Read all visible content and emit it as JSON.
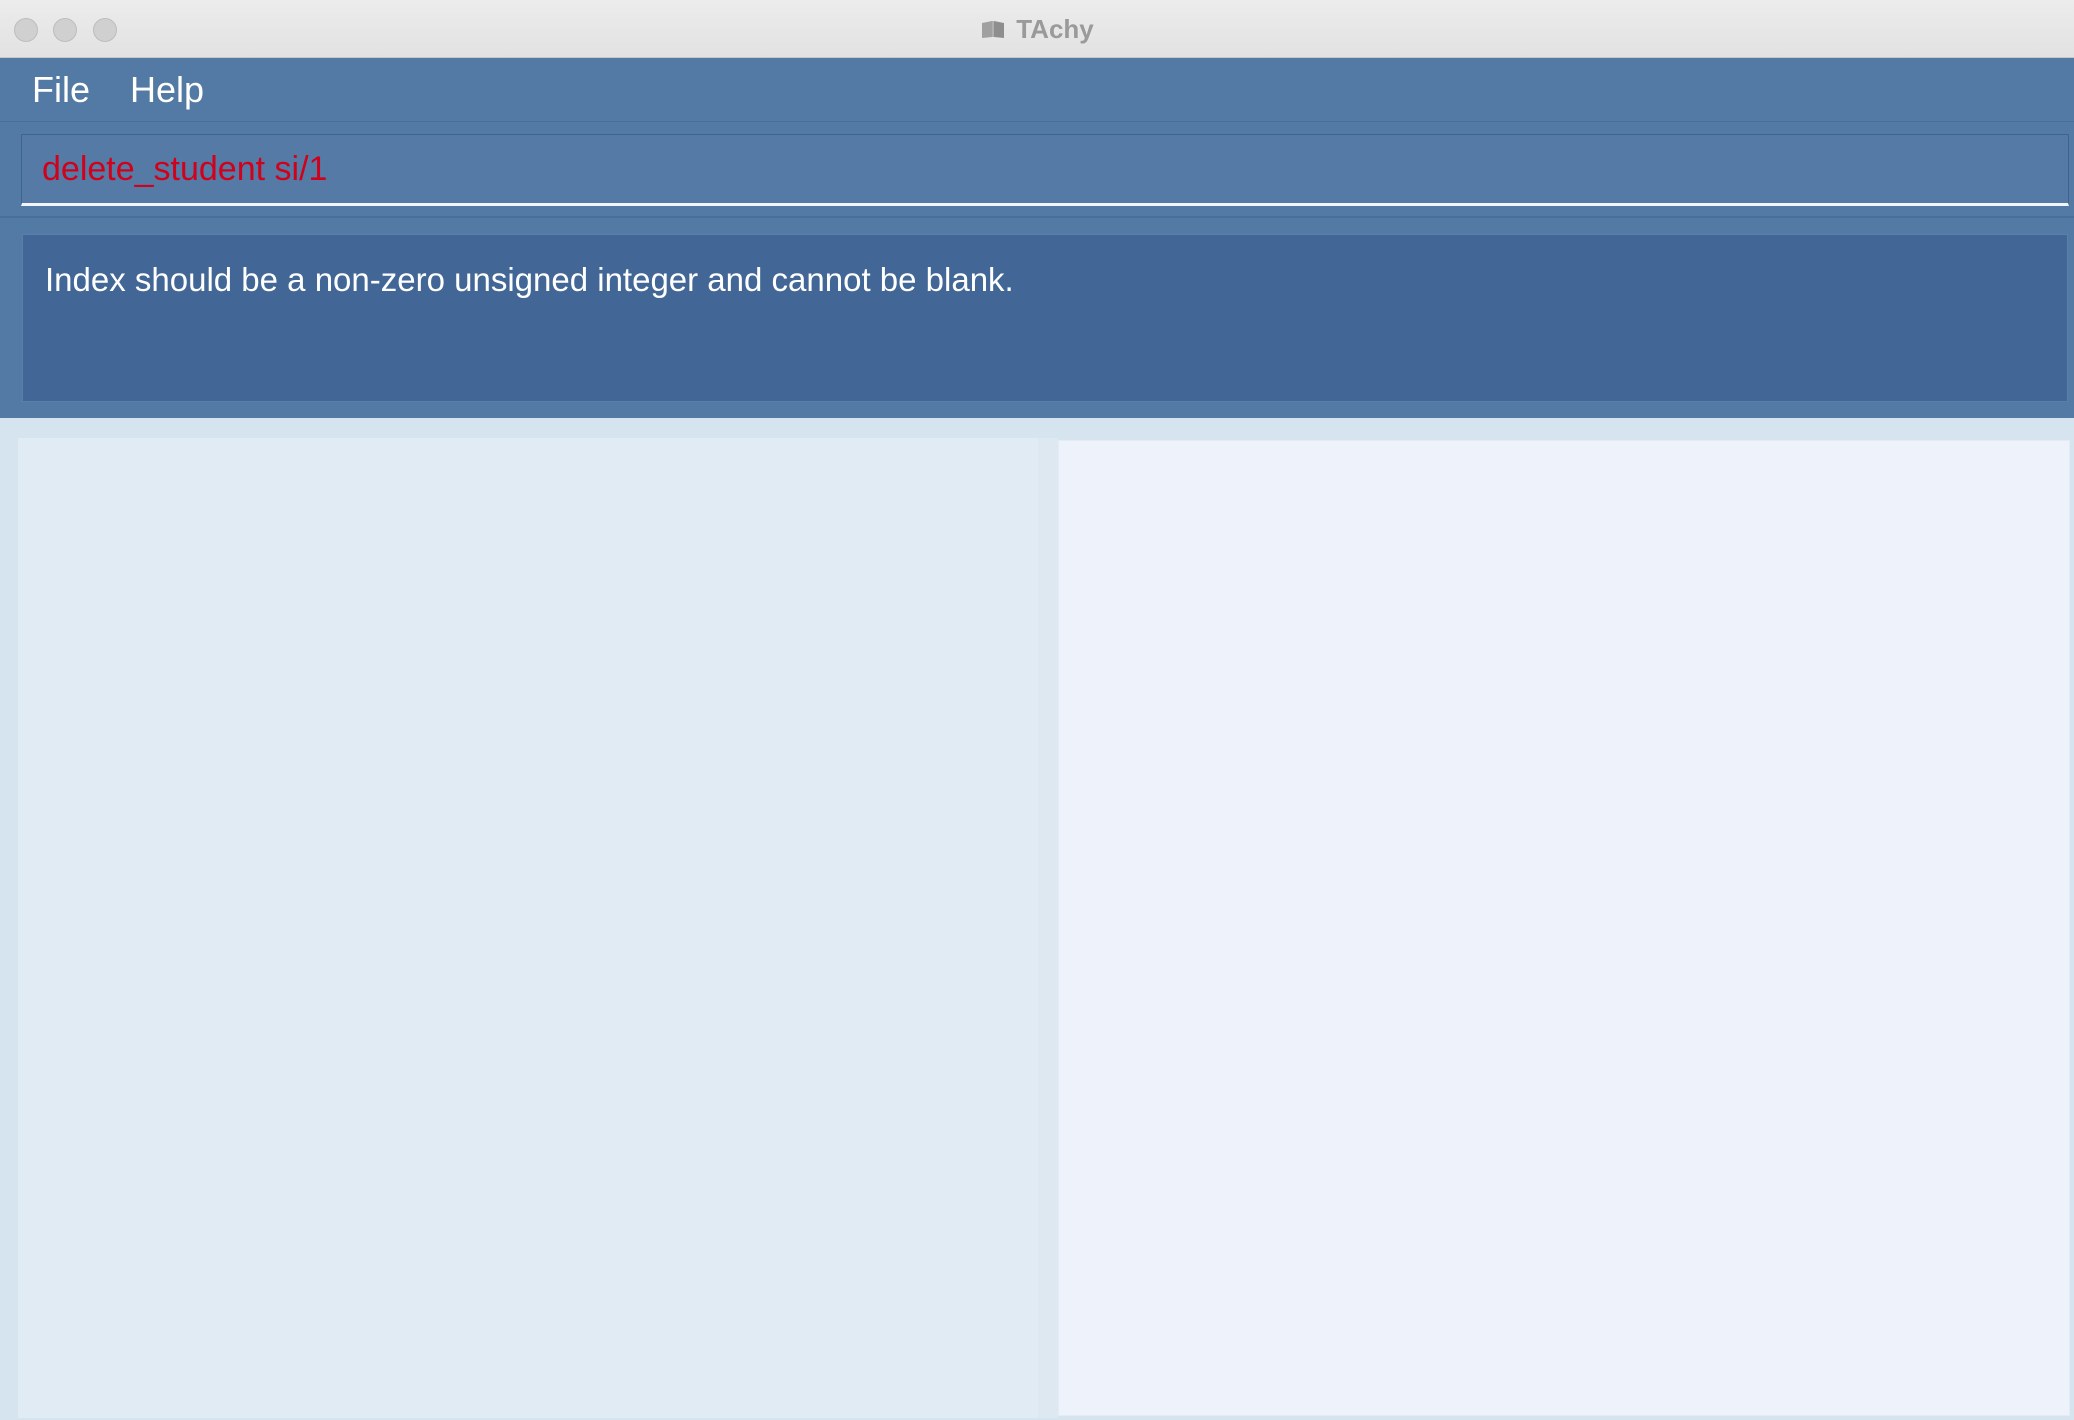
{
  "window": {
    "title": "TAchy",
    "app_icon": "book-icon"
  },
  "menu": {
    "items": [
      {
        "label": "File"
      },
      {
        "label": "Help"
      }
    ]
  },
  "command": {
    "value": "delete_student si/1",
    "text_color": "#d0021b"
  },
  "result": {
    "message": "Index should be a non-zero unsigned integer and cannot be blank."
  },
  "colors": {
    "accent": "#537aa5",
    "result_bg": "#426796",
    "left_panel": "#e1ebf4",
    "right_panel": "#eef3fb"
  }
}
